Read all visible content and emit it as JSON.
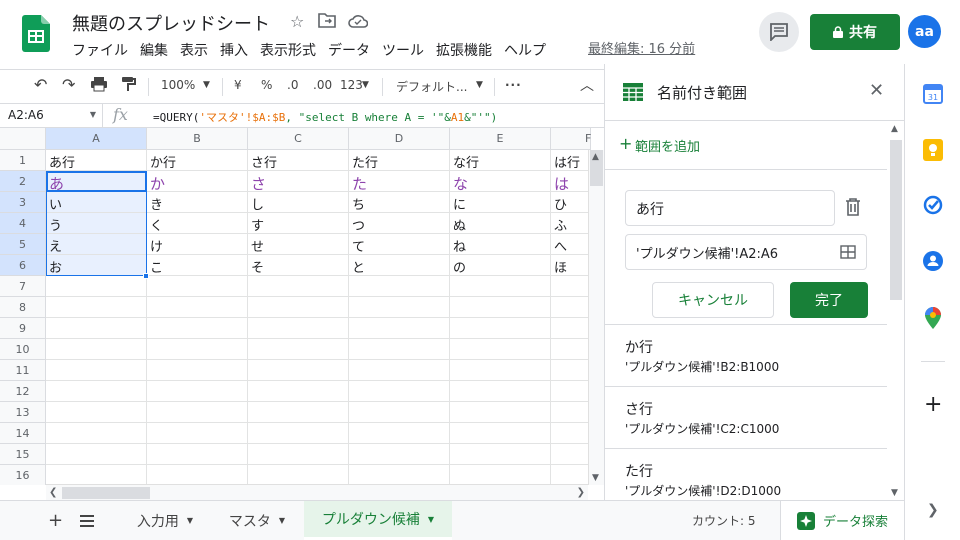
{
  "app": {
    "title": "無題のスプレッドシート",
    "last_edit": "最終編集: 16 分前",
    "share_label": "共有",
    "avatar_initials": "aa"
  },
  "menu": [
    "ファイル",
    "編集",
    "表示",
    "挿入",
    "表示形式",
    "データ",
    "ツール",
    "拡張機能",
    "ヘルプ"
  ],
  "toolbar": {
    "zoom": "100%",
    "currency": "¥",
    "percent": "%",
    "dec_dec": ".0",
    "dec_inc": ".00",
    "format_num": "123",
    "font": "デフォルト..."
  },
  "formula_bar": {
    "name_box": "A2:A6",
    "formula_prefix": "=QUERY(",
    "formula_range": "'マスタ'!$A:$B",
    "formula_rest": ", \"select B where A = '\"&",
    "formula_ref": "A1",
    "formula_end": "&\"'\")"
  },
  "columns": [
    "A",
    "B",
    "C",
    "D",
    "E",
    "F"
  ],
  "rows": [
    "1",
    "2",
    "3",
    "4",
    "5",
    "6",
    "7",
    "8",
    "9",
    "10",
    "11",
    "12",
    "13",
    "14",
    "15",
    "16"
  ],
  "cells": [
    [
      "あ行",
      "か行",
      "さ行",
      "た行",
      "な行",
      "は行"
    ],
    [
      "あ",
      "か",
      "さ",
      "た",
      "な",
      "は"
    ],
    [
      "い",
      "き",
      "し",
      "ち",
      "に",
      "ひ"
    ],
    [
      "う",
      "く",
      "す",
      "つ",
      "ぬ",
      "ふ"
    ],
    [
      "え",
      "け",
      "せ",
      "て",
      "ね",
      "へ"
    ],
    [
      "お",
      "こ",
      "そ",
      "と",
      "の",
      "ほ"
    ]
  ],
  "sheets": [
    "入力用",
    "マスタ",
    "プルダウン候補"
  ],
  "status": {
    "count": "カウント: 5",
    "explore": "データ探索"
  },
  "panel": {
    "title": "名前付き範囲",
    "add_range": "範囲を追加",
    "name_value": "あ行",
    "range_value": "'プルダウン候補'!A2:A6",
    "cancel": "キャンセル",
    "done": "完了",
    "ranges": [
      {
        "name": "か行",
        "ref": "'プルダウン候補'!B2:B1000"
      },
      {
        "name": "さ行",
        "ref": "'プルダウン候補'!C2:C1000"
      },
      {
        "name": "た行",
        "ref": "'プルダウン候補'!D2:D1000"
      }
    ]
  }
}
